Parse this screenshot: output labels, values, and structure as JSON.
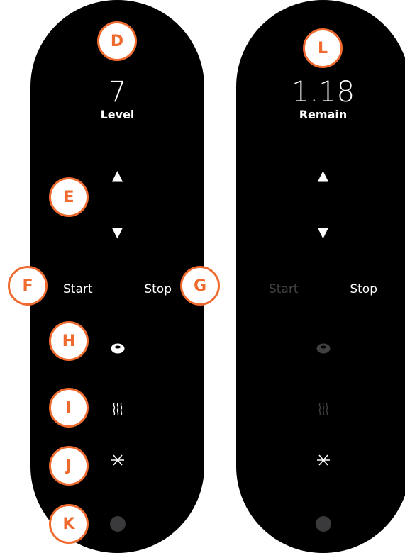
{
  "left_panel": {
    "value": "7",
    "label": "Level",
    "up_symbol": "▲",
    "down_symbol": "▼",
    "start_label": "Start",
    "stop_label": "Stop",
    "start_enabled": true,
    "stop_enabled": true,
    "drop_icon": "drop-icon",
    "heat_icon": "heat-icon",
    "fan_icon": "fan-icon",
    "dot_icon": "led-dot"
  },
  "right_panel": {
    "value": "1.18",
    "label": "Remain",
    "up_symbol": "▲",
    "down_symbol": "▼",
    "start_label": "Start",
    "stop_label": "Stop",
    "start_enabled": false,
    "stop_enabled": true,
    "drop_icon_enabled": false,
    "heat_icon_enabled": false,
    "fan_icon_enabled": true
  },
  "markers": {
    "d": "D",
    "e": "E",
    "f": "F",
    "g": "G",
    "h": "H",
    "i": "I",
    "j": "J",
    "k": "K",
    "l": "L"
  },
  "colors": {
    "panel": "#000000",
    "marker_accent": "#ef6a2e",
    "text": "#ffffff",
    "led": "#3a3a3c"
  }
}
